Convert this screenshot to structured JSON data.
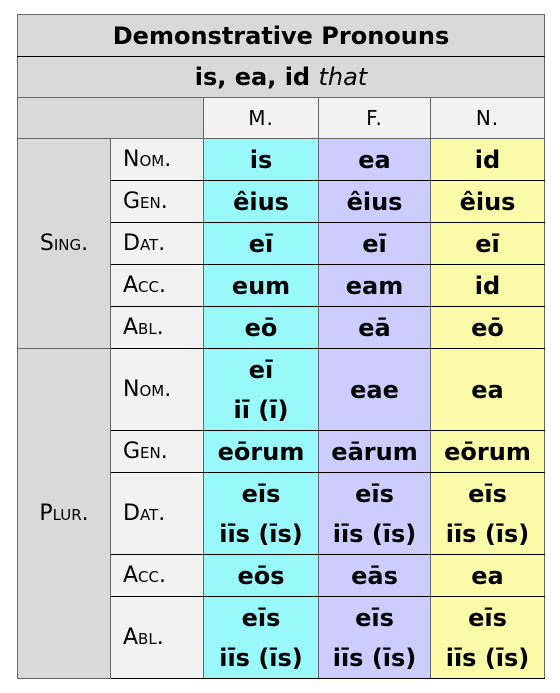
{
  "table": {
    "title": "Demonstrative Pronouns",
    "subtitle_bold": "is, ea, id",
    "subtitle_italic": "that",
    "genders": [
      "M.",
      "F.",
      "N."
    ],
    "colors": {
      "masculine": "#99F8FA",
      "feminine": "#CCCCFF",
      "neuter": "#F9FBA8",
      "header": "#D9D9D9",
      "label": "#F2F2F2"
    },
    "singular": {
      "label": "Sing.",
      "rows": [
        {
          "case": "Nom.",
          "m": [
            "is"
          ],
          "f": [
            "ea"
          ],
          "n": [
            "id"
          ]
        },
        {
          "case": "Gen.",
          "m": [
            "êius"
          ],
          "f": [
            "êius"
          ],
          "n": [
            "êius"
          ]
        },
        {
          "case": "Dat.",
          "m": [
            "eī"
          ],
          "f": [
            "eī"
          ],
          "n": [
            "eī"
          ]
        },
        {
          "case": "Acc.",
          "m": [
            "eum"
          ],
          "f": [
            "eam"
          ],
          "n": [
            "id"
          ]
        },
        {
          "case": "Abl.",
          "m": [
            "eō"
          ],
          "f": [
            "eā"
          ],
          "n": [
            "eō"
          ]
        }
      ]
    },
    "plural": {
      "label": "Plur.",
      "rows": [
        {
          "case": "Nom.",
          "m": [
            "eī",
            "iī (ī)"
          ],
          "f": [
            "eae"
          ],
          "n": [
            "ea"
          ]
        },
        {
          "case": "Gen.",
          "m": [
            "eōrum"
          ],
          "f": [
            "eārum"
          ],
          "n": [
            "eōrum"
          ]
        },
        {
          "case": "Dat.",
          "m": [
            "eīs",
            "iīs (īs)"
          ],
          "f": [
            "eīs",
            "iīs (īs)"
          ],
          "n": [
            "eīs",
            "iīs (īs)"
          ]
        },
        {
          "case": "Acc.",
          "m": [
            "eōs"
          ],
          "f": [
            "eās"
          ],
          "n": [
            "ea"
          ]
        },
        {
          "case": "Abl.",
          "m": [
            "eīs",
            "iīs (īs)"
          ],
          "f": [
            "eīs",
            "iīs (īs)"
          ],
          "n": [
            "eīs",
            "iīs (īs)"
          ]
        }
      ]
    }
  }
}
